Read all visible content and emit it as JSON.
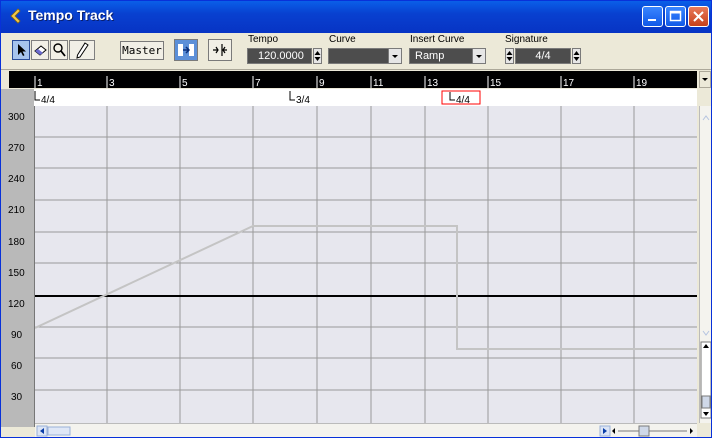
{
  "window": {
    "title": "Tempo Track"
  },
  "toolbar": {
    "master_label": "Master",
    "tempo": {
      "label": "Tempo",
      "value": "120.0000"
    },
    "curve": {
      "label": "Curve",
      "value": ""
    },
    "insert_curve": {
      "label": "Insert Curve",
      "value": "Ramp"
    },
    "signature": {
      "label": "Signature",
      "value": "4/4"
    }
  },
  "ruler": {
    "bars": [
      "1",
      "3",
      "5",
      "7",
      "9",
      "11",
      "13",
      "15",
      "17",
      "19"
    ]
  },
  "signatures": [
    {
      "label": "4/4",
      "selected": false
    },
    {
      "label": "3/4",
      "selected": false
    },
    {
      "label": "4/4",
      "selected": true
    }
  ],
  "tempo_axis": {
    "ticks": [
      "300",
      "270",
      "240",
      "210",
      "180",
      "150",
      "120",
      "90",
      "60",
      "30"
    ]
  },
  "colors": {
    "titlebar": "#0a5fe8",
    "grid_bg": "#e7e7ee",
    "grid_line": "#9a9a9a",
    "tempo_line": "#000000",
    "curve_line": "#c4c4c4",
    "selection": "#ff0000"
  },
  "icons": [
    "arrow-tool-icon",
    "eraser-tool-icon",
    "magnifier-tool-icon",
    "pencil-tool-icon"
  ]
}
